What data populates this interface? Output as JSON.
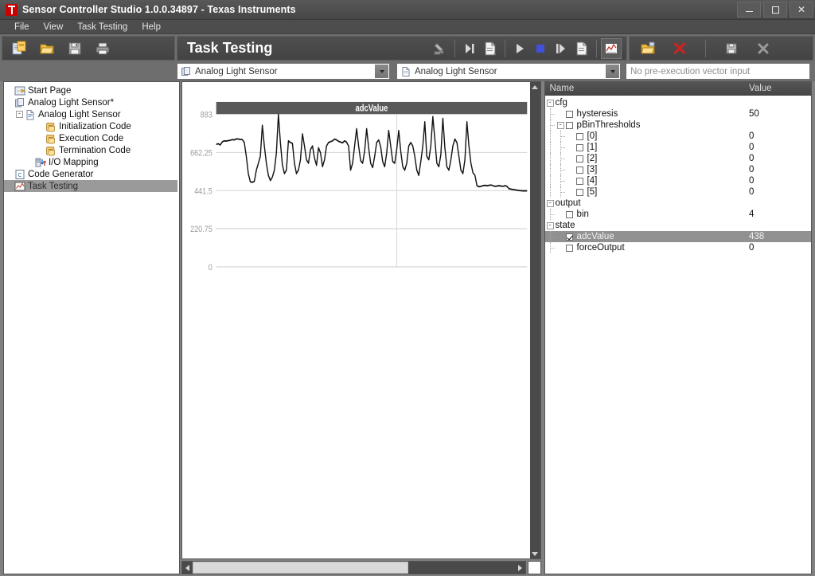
{
  "window": {
    "title": "Sensor Controller Studio 1.0.0.34897 - Texas Instruments",
    "logo_color": "#cc0000",
    "minimize_label": "",
    "maximize_label": "",
    "close_label": "✕"
  },
  "menubar": {
    "items": [
      {
        "label": "File"
      },
      {
        "label": "View"
      },
      {
        "label": "Task Testing"
      },
      {
        "label": "Help"
      }
    ]
  },
  "toolbar_left": {
    "buttons": [
      {
        "name": "new-project-button",
        "icon": "new-document-icon",
        "label": ""
      },
      {
        "name": "open-project-button",
        "icon": "open-folder-icon",
        "label": ""
      },
      {
        "name": "save-project-button",
        "icon": "floppy-save-icon",
        "label": ""
      },
      {
        "name": "print-button",
        "icon": "printer-icon",
        "label": ""
      }
    ]
  },
  "toolbar_center": {
    "page_title": "Task Testing",
    "buttons": [
      {
        "name": "connect-device-button",
        "icon": "plug-icon"
      },
      {
        "name": "step-to-end-button",
        "icon": "step-end-icon"
      },
      {
        "name": "log-report-button",
        "icon": "report-icon"
      },
      {
        "name": "run-button",
        "icon": "play-icon"
      },
      {
        "name": "stop-button",
        "icon": "stop-square-icon"
      },
      {
        "name": "step-button",
        "icon": "step-over-icon"
      },
      {
        "name": "export-log-button",
        "icon": "report-export-icon"
      },
      {
        "name": "show-graph-button",
        "icon": "chart-icon"
      }
    ]
  },
  "toolbar_right": {
    "buttons": [
      {
        "name": "load-vector-button",
        "icon": "open-folder-small-icon"
      },
      {
        "name": "clear-vector-button",
        "icon": "red-x-icon"
      },
      {
        "name": "save-vector-button",
        "icon": "floppy-small-icon"
      },
      {
        "name": "close-vector-button",
        "icon": "grey-x-icon"
      }
    ]
  },
  "selectors": {
    "sensor_controller": {
      "value": "Analog Light Sensor",
      "icon": "project-icon"
    },
    "task": {
      "value": "Analog Light Sensor",
      "icon": "task-document-icon"
    },
    "vector_input": {
      "placeholder": "No pre-execution vector input",
      "value": ""
    }
  },
  "project_tree": {
    "nodes": [
      {
        "label": "Start Page",
        "icon": "start-page-icon",
        "indent": 0,
        "expander": null,
        "selected": false
      },
      {
        "label": "Analog Light Sensor*",
        "icon": "project-icon",
        "indent": 0,
        "expander": null,
        "selected": false
      },
      {
        "label": "Analog Light Sensor",
        "icon": "task-document-icon",
        "indent": 1,
        "expander": "-",
        "selected": false
      },
      {
        "label": "Initialization Code",
        "icon": "code-scroll-icon",
        "indent": 3,
        "expander": null,
        "selected": false
      },
      {
        "label": "Execution Code",
        "icon": "code-scroll-icon",
        "indent": 3,
        "expander": null,
        "selected": false
      },
      {
        "label": "Termination Code",
        "icon": "code-scroll-icon",
        "indent": 3,
        "expander": null,
        "selected": false
      },
      {
        "label": "I/O Mapping",
        "icon": "io-mapping-icon",
        "indent": 2,
        "expander": null,
        "selected": false
      },
      {
        "label": "Code Generator",
        "icon": "code-generator-icon",
        "indent": 0,
        "expander": null,
        "selected": false
      },
      {
        "label": "Task Testing",
        "icon": "chart-small-icon",
        "indent": 0,
        "expander": null,
        "selected": true
      }
    ]
  },
  "property_panel": {
    "columns": {
      "name": "Name",
      "value": "Value"
    },
    "rows": [
      {
        "label": "cfg",
        "value": "",
        "indent": 0,
        "expander": "-",
        "checkbox": null,
        "selected": false
      },
      {
        "label": "hysteresis",
        "value": "50",
        "indent": 1,
        "expander": null,
        "checkbox": false,
        "selected": false
      },
      {
        "label": "pBinThresholds",
        "value": "",
        "indent": 1,
        "expander": "-",
        "checkbox": false,
        "selected": false
      },
      {
        "label": "[0]",
        "value": "0",
        "indent": 2,
        "expander": null,
        "checkbox": false,
        "selected": false
      },
      {
        "label": "[1]",
        "value": "0",
        "indent": 2,
        "expander": null,
        "checkbox": false,
        "selected": false
      },
      {
        "label": "[2]",
        "value": "0",
        "indent": 2,
        "expander": null,
        "checkbox": false,
        "selected": false
      },
      {
        "label": "[3]",
        "value": "0",
        "indent": 2,
        "expander": null,
        "checkbox": false,
        "selected": false
      },
      {
        "label": "[4]",
        "value": "0",
        "indent": 2,
        "expander": null,
        "checkbox": false,
        "selected": false
      },
      {
        "label": "[5]",
        "value": "0",
        "indent": 2,
        "expander": null,
        "checkbox": false,
        "selected": false
      },
      {
        "label": "output",
        "value": "",
        "indent": 0,
        "expander": "-",
        "checkbox": null,
        "selected": false
      },
      {
        "label": "bin",
        "value": "4",
        "indent": 1,
        "expander": null,
        "checkbox": false,
        "selected": false
      },
      {
        "label": "state",
        "value": "",
        "indent": 0,
        "expander": "-",
        "checkbox": null,
        "selected": false
      },
      {
        "label": "adcValue",
        "value": "438",
        "indent": 1,
        "expander": null,
        "checkbox": true,
        "selected": true
      },
      {
        "label": "forceOutput",
        "value": "0",
        "indent": 1,
        "expander": null,
        "checkbox": false,
        "selected": false
      }
    ]
  },
  "scrollbars": {
    "horizontal": {
      "thumb_start_pct": 1.5,
      "thumb_width_pct": 63
    },
    "vertical": {
      "up_arrow": "▲",
      "down_arrow": "▼"
    }
  },
  "chart_data": {
    "type": "line",
    "title": "adcValue",
    "xlabel": "",
    "ylabel": "",
    "ylim": [
      0,
      883
    ],
    "yticks": [
      0,
      220.75,
      441.5,
      662.25,
      883
    ],
    "ytick_labels": [
      "0",
      "220.75",
      "441.5",
      "662.25",
      "883"
    ],
    "grid": true,
    "vertical_gridlines_x": [
      90,
      186
    ],
    "legend": null,
    "line_color": "#111111",
    "series": [
      {
        "name": "adcValue",
        "values": [
          709,
          713,
          706,
          723,
          730,
          728,
          731,
          733,
          737,
          735,
          741,
          740,
          738,
          737,
          720,
          640,
          540,
          492,
          490,
          495,
          560,
          600,
          640,
          820,
          700,
          600,
          530,
          500,
          520,
          560,
          660,
          883,
          720,
          590,
          540,
          560,
          730,
          720,
          715,
          600,
          540,
          560,
          620,
          770,
          700,
          620,
          600,
          680,
          700,
          630,
          588,
          690,
          660,
          580,
          620,
          700,
          720,
          725,
          730,
          740,
          735,
          727,
          723,
          718,
          730,
          722,
          700,
          560,
          600,
          700,
          800,
          700,
          615,
          600,
          670,
          800,
          690,
          600,
          575,
          640,
          720,
          735,
          695,
          610,
          580,
          660,
          790,
          700,
          610,
          600,
          680,
          790,
          670,
          580,
          560,
          600,
          700,
          720,
          700,
          640,
          560,
          530,
          610,
          700,
          840,
          640,
          620,
          700,
          870,
          740,
          600,
          580,
          650,
          860,
          690,
          580,
          560,
          620,
          700,
          740,
          720,
          640,
          560,
          540,
          620,
          840,
          700,
          600,
          545,
          530,
          470,
          464,
          466,
          470,
          472,
          470,
          472,
          474,
          470,
          466,
          468,
          470,
          468,
          466,
          470,
          466,
          452,
          450,
          448,
          446,
          444,
          442,
          441,
          440,
          440,
          440
        ]
      }
    ]
  }
}
